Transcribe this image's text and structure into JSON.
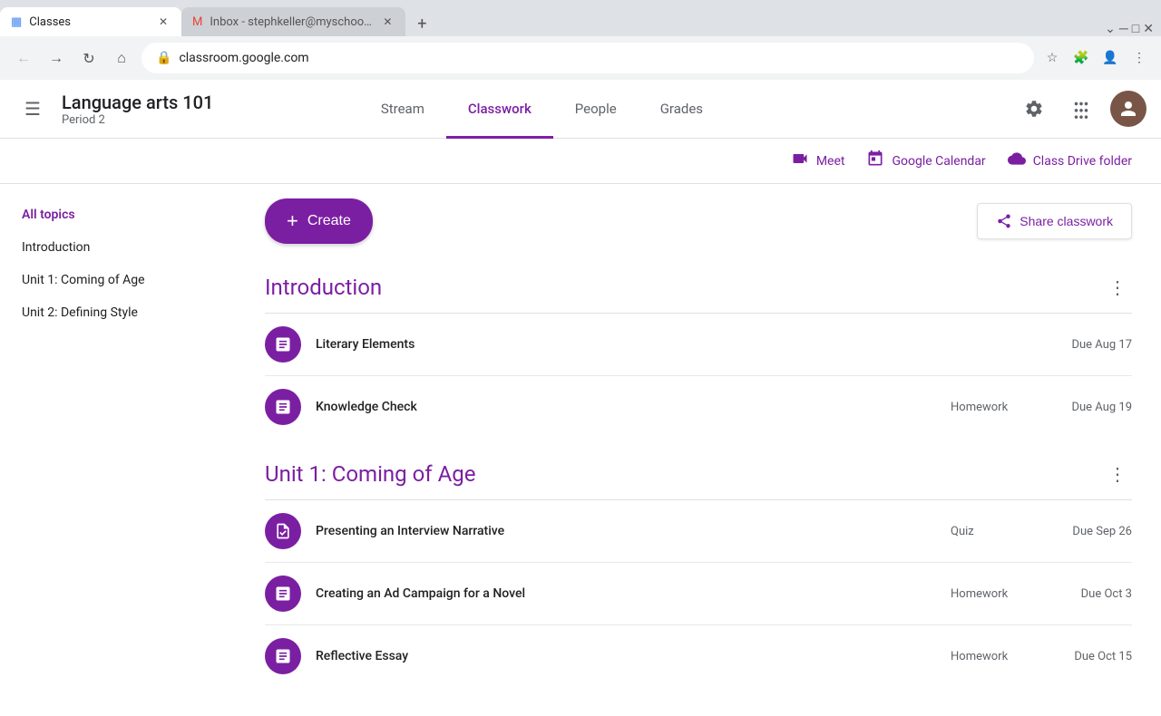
{
  "browser": {
    "tabs": [
      {
        "id": "tab-classes",
        "favicon": "🟦",
        "label": "Classes",
        "active": true
      },
      {
        "id": "tab-gmail",
        "favicon": "✉",
        "label": "Inbox - stephkeller@myschool.edu",
        "active": false
      }
    ],
    "new_tab_label": "+",
    "address": "classroom.google.com"
  },
  "header": {
    "menu_icon": "☰",
    "class_name": "Language arts 101",
    "period": "Period 2",
    "tabs": [
      {
        "id": "stream",
        "label": "Stream",
        "active": false
      },
      {
        "id": "classwork",
        "label": "Classwork",
        "active": true
      },
      {
        "id": "people",
        "label": "People",
        "active": false
      },
      {
        "id": "grades",
        "label": "Grades",
        "active": false
      }
    ],
    "settings_icon": "⚙",
    "apps_icon": "⠿"
  },
  "quick_links": [
    {
      "id": "meet",
      "icon": "📹",
      "label": "Meet"
    },
    {
      "id": "calendar",
      "icon": "📅",
      "label": "Google Calendar"
    },
    {
      "id": "drive",
      "icon": "📁",
      "label": "Class Drive folder"
    }
  ],
  "sidebar": {
    "items": [
      {
        "id": "all-topics",
        "label": "All topics",
        "active": true
      },
      {
        "id": "introduction",
        "label": "Introduction",
        "active": false
      },
      {
        "id": "unit1",
        "label": "Unit 1: Coming of Age",
        "active": false
      },
      {
        "id": "unit2",
        "label": "Unit 2: Defining Style",
        "active": false
      }
    ]
  },
  "actions": {
    "create_label": "Create",
    "share_label": "Share classwork"
  },
  "topics": [
    {
      "id": "introduction",
      "title": "Introduction",
      "assignments": [
        {
          "id": "literary-elements",
          "name": "Literary Elements",
          "type": "",
          "due": "Due Aug 17",
          "icon": "assignment"
        },
        {
          "id": "knowledge-check",
          "name": "Knowledge Check",
          "type": "Homework",
          "due": "Due Aug 19",
          "icon": "assignment"
        }
      ]
    },
    {
      "id": "unit1",
      "title": "Unit 1: Coming of Age",
      "assignments": [
        {
          "id": "presenting-interview",
          "name": "Presenting an Interview Narrative",
          "type": "Quiz",
          "due": "Due Sep 26",
          "icon": "quiz"
        },
        {
          "id": "ad-campaign",
          "name": "Creating an Ad Campaign for a Novel",
          "type": "Homework",
          "due": "Due Oct 3",
          "icon": "assignment"
        },
        {
          "id": "reflective-essay",
          "name": "Reflective Essay",
          "type": "Homework",
          "due": "Due Oct 15",
          "icon": "assignment"
        }
      ]
    }
  ],
  "colors": {
    "purple": "#7b1fa2",
    "light_purple": "#9c27b0",
    "text_secondary": "#5f6368"
  }
}
